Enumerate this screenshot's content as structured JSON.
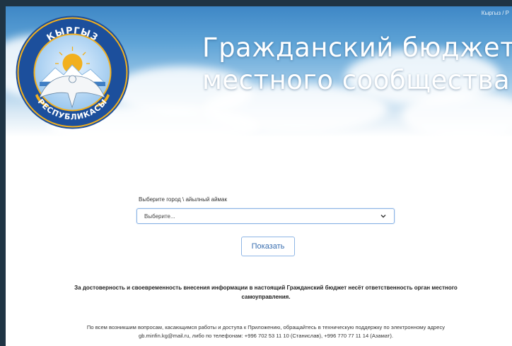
{
  "header": {
    "lang_switch": "Кыргыз / Р",
    "title_line1": "Гражданский бюджет",
    "title_line2": "местного сообщества",
    "emblem": {
      "top_text": "КЫРГЫЗ",
      "bottom_text": "РЕСПУБЛИКАСЫ"
    }
  },
  "form": {
    "select_label": "Выберите город \\ айылный аймак",
    "select_value": "Выберите...",
    "show_button": "Показать"
  },
  "notice": {
    "line1": "За достоверность и своевременность внесения информации в настоящий Гражданский бюджет несёт ответственность орган местного",
    "line2": "самоуправления."
  },
  "support": {
    "line1": "По всем возникшим вопросам, касающимся работы и доступа к Приложению, обращайтесь в техническую поддержку по электронному адресу",
    "line2": "gb.minfin.kg@mail.ru, либо по телефонам: +996 702 53 11 10 (Станислав), +996 770 77 11 14 (Азамат)."
  },
  "colors": {
    "page_background": "#1f3444",
    "sky": "#5ea3d6",
    "emblem_blue": "#1c4f9c",
    "emblem_gold": "#f2b01e",
    "button_text": "#3a6fb0",
    "input_border": "#8fb6e6"
  },
  "icons": [
    "chevron-down-icon",
    "state-emblem-icon",
    "eagle-icon",
    "sun-icon",
    "mountains-icon"
  ]
}
